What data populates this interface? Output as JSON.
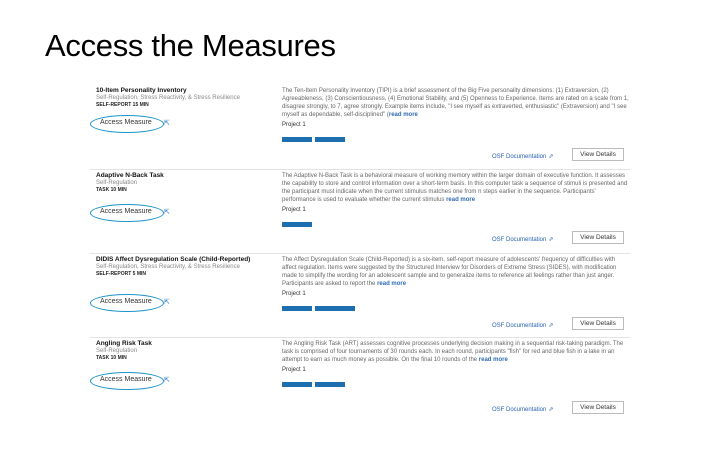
{
  "slide": {
    "title": "Access the Measures"
  },
  "cards": [
    {
      "name": "10-Item Personality Inventory",
      "category": "Self-Regulation, Stress Reactivity, & Stress Resilience",
      "time": "SELF-REPORT 15 MIN",
      "access_label": "Access Measure",
      "description": "The Ten-Item Personality Inventory (TIPI) is a brief assessment of the Big Five personality dimensions: (1) Extraversion, (2) Agreeableness, (3) Conscientiousness, (4) Emotional Stability, and (5) Openness to Experience. Items are rated on a scale from 1, disagree strongly, to 7, agree strongly. Example items include, \"I see myself as extraverted, enthusiastic\" (Extraversion) and \"I see myself as dependable, self-disciplined\" (",
      "read_more": "read more",
      "project": "Project 1",
      "osf_label": "OSF Documentation",
      "details_label": "View Details"
    },
    {
      "name": "Adaptive N-Back Task",
      "category": "Self-Regulation",
      "time": "TASK 10 MIN",
      "access_label": "Access Measure",
      "description": "The Adaptive N-Back Task is a behavioral measure of working memory within the larger domain of executive function. It assesses the capability to store and control information over a short-term basis. In this computer task a sequence of stimuli is presented and the participant must indicate when the current stimulus matches one from n steps earlier in the sequence. Participants' performance is used to evaluate whether the current stimulus ",
      "read_more": "read more",
      "project": "Project 1",
      "osf_label": "OSF Documentation",
      "details_label": "View Details"
    },
    {
      "name": "DIDIS Affect Dysregulation Scale (Child-Reported)",
      "category": "Self-Regulation, Stress Reactivity, & Stress Resilience",
      "time": "SELF-REPORT 5 MIN",
      "access_label": "Access Measure",
      "description": "The Affect Dysregulation Scale (Child-Reported) is a six-item, self-report measure of adolescents' frequency of difficulties with affect regulation. Items were suggested by the Structured Interview for Disorders of Extreme Stress (SIDES), with modification made to simplify the wording for an adolescent sample and to generalize items to reference all feelings rather than just anger. Participants are asked to report the ",
      "read_more": "read more",
      "project": "Project 1",
      "osf_label": "OSF Documentation",
      "details_label": "View Details"
    },
    {
      "name": "Angling Risk Task",
      "category": "Self-Regulation",
      "time": "TASK 10 MIN",
      "access_label": "Access Measure",
      "description": "The Angling Risk Task (ART) assesses cognitive processes underlying decision making in a sequential risk-taking paradigm. The task is comprised of four tournaments of 30 rounds each. In each round, participants \"fish\" for red and blue fish in a lake in an attempt to earn as much money as possible. On the final 10 rounds of the ",
      "read_more": "read more",
      "project": "Project 1",
      "osf_label": "OSF Documentation",
      "details_label": "View Details"
    }
  ]
}
